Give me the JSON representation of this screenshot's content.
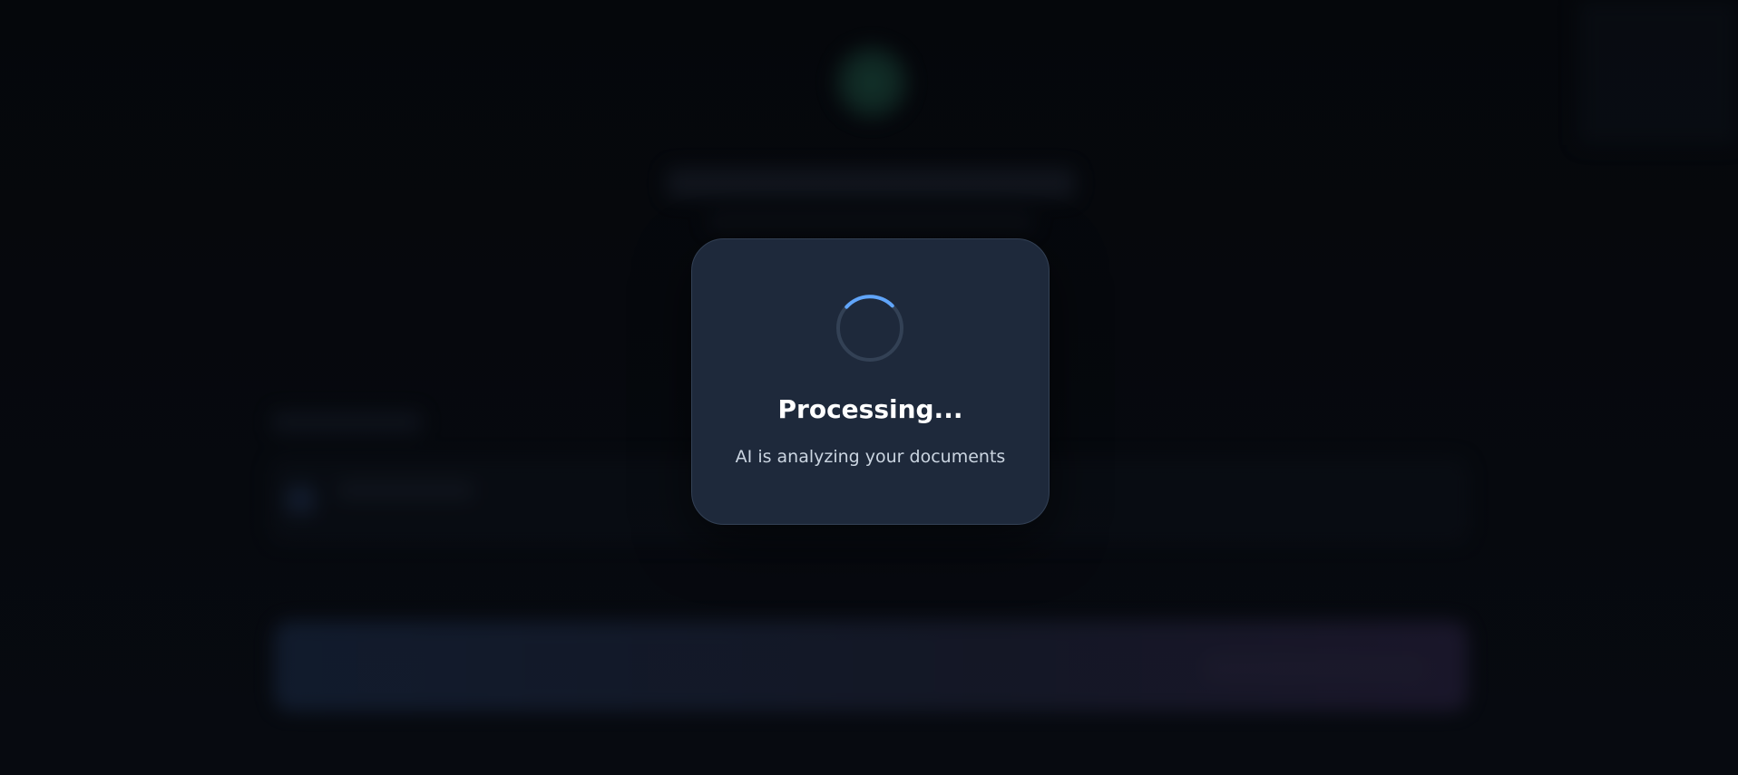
{
  "modal": {
    "title": "Processing...",
    "subtitle": "AI is analyzing your documents",
    "spinner_icon": "loading-spinner-icon",
    "colors": {
      "card_background": "#1e293b",
      "card_border": "#334155",
      "spinner_track": "#334155",
      "spinner_accent": "#60a5fa",
      "title": "#ffffff",
      "subtitle": "#cbd5e1"
    }
  },
  "backdrop": {
    "color": "#06080c",
    "state": "blurred"
  }
}
